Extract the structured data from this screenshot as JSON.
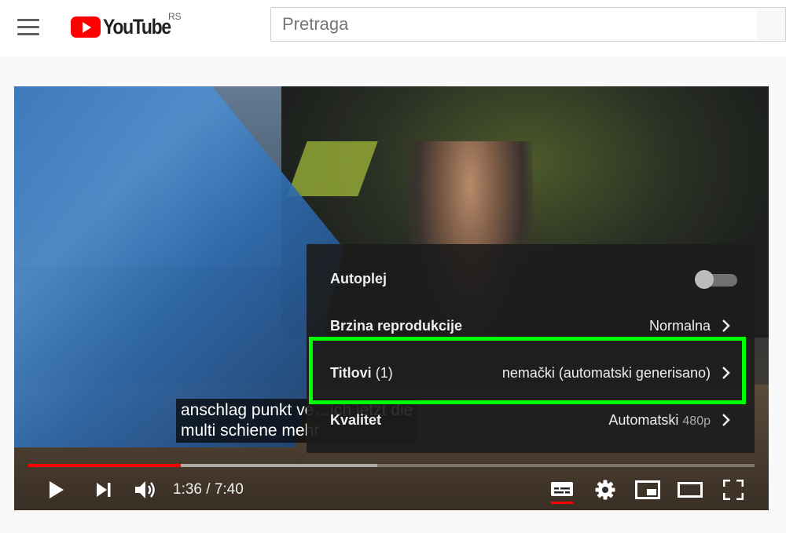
{
  "header": {
    "logo_text": "YouTube",
    "country": "RS",
    "search_placeholder": "Pretraga"
  },
  "player": {
    "subtitle_lines": "anschlag punkt ve…ich jetzt die\nmulti schiene mehr",
    "time_current": "1:36",
    "time_separator": " / ",
    "time_total": "7:40",
    "progress_played_fraction": 0.21,
    "progress_loaded_fraction": 0.48,
    "captions_active": true
  },
  "settings_menu": {
    "autoplay": {
      "label": "Autoplej",
      "enabled": false
    },
    "speed": {
      "label": "Brzina reprodukcije",
      "value": "Normalna"
    },
    "subtitles": {
      "label": "Titlovi",
      "count": "(1)",
      "value": "nemački (automatski generisano)"
    },
    "quality": {
      "label": "Kvalitet",
      "value": "Automatski",
      "value_sub": "480p"
    }
  },
  "highlight_color": "#00ff00",
  "accent_color": "#ff0000"
}
